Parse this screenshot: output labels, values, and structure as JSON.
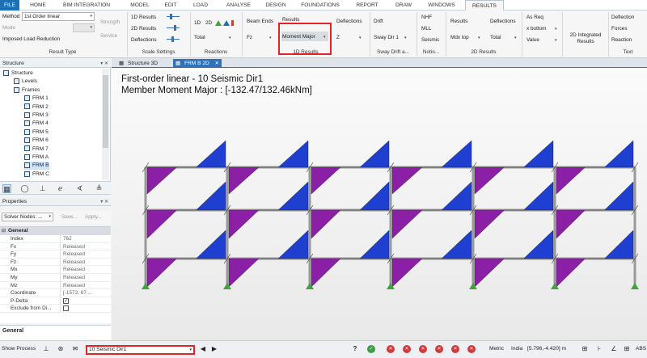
{
  "menu": {
    "tabs": [
      "FILE",
      "HOME",
      "BIM INTEGRATION",
      "MODEL",
      "EDIT",
      "LOAD",
      "ANALYSE",
      "DESIGN",
      "FOUNDATIONS",
      "REPORT",
      "DRAW",
      "WINDOWS",
      "RESULTS"
    ],
    "active": "RESULTS"
  },
  "ribbon": {
    "result_type": {
      "method_label": "Method",
      "method_value": "1st Order linear",
      "mode_label": "Mode",
      "mode_value": "",
      "imposed_label": "Imposed Load Reduction",
      "strength_label": "Strength",
      "service_label": "Service",
      "group_label": "Result Type"
    },
    "scale_settings": {
      "results_1d": "1D Results",
      "results_2d": "2D Results",
      "deflections": "Deflections",
      "group_label": "Scale Settings"
    },
    "reactions": {
      "btn_1d": "1D",
      "btn_2d": "2D",
      "total_value": "Total",
      "group_label": "Reactions"
    },
    "results_1d": {
      "beam_ends": "Beam Ends",
      "fz_value": "Fz",
      "results_label": "Results",
      "moment_value": "Moment Major",
      "deflections": "Deflections",
      "z_value": "Z",
      "group_label": "1D Results"
    },
    "sway": {
      "drift": "Drift",
      "sway_value": "Sway Dir 1",
      "group_label": "Sway Drift a..."
    },
    "notional": {
      "nhf": "NHF",
      "mll": "MLL",
      "seismic": "Seismic",
      "group_label": "Notio..."
    },
    "results_2d": {
      "results_label": "Results",
      "mdx_value": "Mdx top",
      "deflections": "Deflections",
      "total_value": "Total",
      "group_label": "2D Results"
    },
    "reinforcement": {
      "as_req": "As Req",
      "x_bottom": "x bottom",
      "value": "Value"
    },
    "integrated": {
      "label": "2D Integrated Results"
    },
    "text": {
      "deflection": "Deflection",
      "forces": "Forces",
      "reaction": "Reaction",
      "group_label": "Text"
    }
  },
  "structure_panel": {
    "title": "Structure",
    "pin": "▾ ✕",
    "items": [
      {
        "label": "Structure",
        "level": 0
      },
      {
        "label": "Levels",
        "level": 1
      },
      {
        "label": "Frames",
        "level": 1
      },
      {
        "label": "FRM 1",
        "level": 2
      },
      {
        "label": "FRM 2",
        "level": 2
      },
      {
        "label": "FRM 3",
        "level": 2
      },
      {
        "label": "FRM 4",
        "level": 2
      },
      {
        "label": "FRM 5",
        "level": 2
      },
      {
        "label": "FRM 6",
        "level": 2
      },
      {
        "label": "FRM 7",
        "level": 2
      },
      {
        "label": "FRM A",
        "level": 2
      },
      {
        "label": "FRM B",
        "level": 2
      },
      {
        "label": "FRM C",
        "level": 2
      }
    ],
    "selected": "FRM B"
  },
  "properties_panel": {
    "title": "Properties",
    "pin": "▾ ✕",
    "filter_value": "Solver Nodes: ...",
    "save_label": "Save...",
    "apply_label": "Apply...",
    "category": "General",
    "rows": [
      {
        "key": "Index",
        "value": "762"
      },
      {
        "key": "Fx",
        "value": "Released"
      },
      {
        "key": "Fy",
        "value": "Released"
      },
      {
        "key": "Fz",
        "value": "Released"
      },
      {
        "key": "Mx",
        "value": "Released"
      },
      {
        "key": "My",
        "value": "Released"
      },
      {
        "key": "Mz",
        "value": "Released"
      },
      {
        "key": "Coordinate",
        "value": "[-1573, 87...."
      },
      {
        "key": "P-Delta",
        "value": ""
      },
      {
        "key": "Exclude from Di...",
        "value": ""
      }
    ],
    "footer": "General"
  },
  "doc_tabs": [
    {
      "label": "Structure 3D",
      "active": false
    },
    {
      "label": "FRM B 2D",
      "active": true
    }
  ],
  "canvas": {
    "line1": "First-order linear - 10 Seismic Dir1",
    "line2": "Member Moment Major  : [-132.47/132.46kNm]",
    "colors": {
      "positive": "#1f3fd0",
      "negative": "#8b1fa6",
      "frame": "#9a9a9a",
      "support": "#3ea53e"
    }
  },
  "statusbar": {
    "show_process": "Show Process",
    "loadcase_value": "10 Seismic Dir1",
    "metric": "Metric",
    "country": "India",
    "coords": "[5.796,-4.420] m",
    "abs": "ABS"
  }
}
